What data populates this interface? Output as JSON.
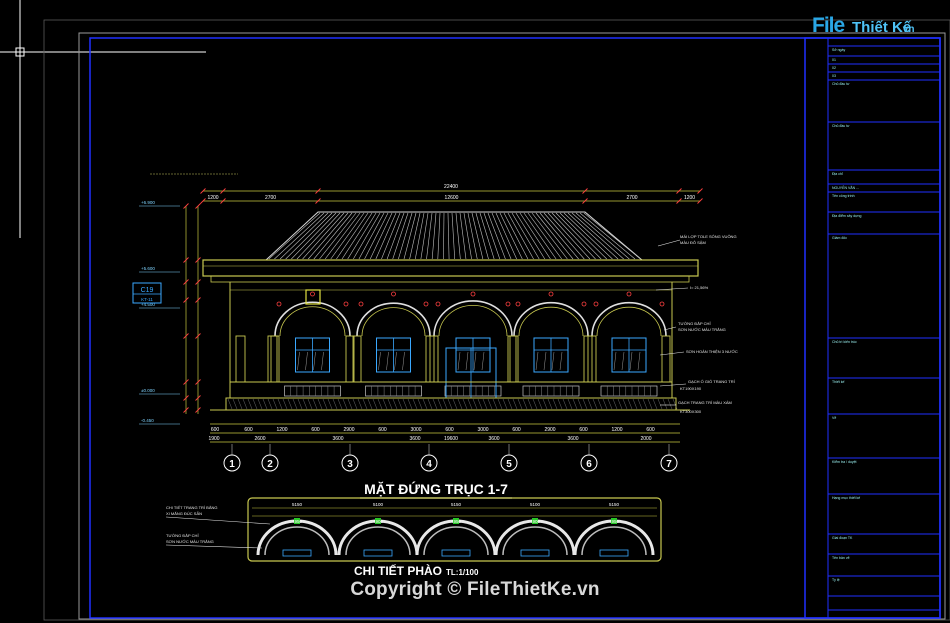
{
  "watermark": {
    "brand_first": "File",
    "brand_rest": "Thiết Kế",
    "brand_suffix": ".vn"
  },
  "copyright": "Copyright © FileThietKe.vn",
  "drawing": {
    "main_title": "MẶT ĐỨNG TRỤC 1-7",
    "detail_title": "CHI TIẾT PHÀO",
    "detail_scale": "TL:1/100",
    "section_tag": "C19",
    "section_sub": "KT-11",
    "top_dims": [
      "1200",
      "2700",
      "12600",
      "2700",
      "1200"
    ],
    "overall_dim": "22400",
    "bottom_dims": [
      "600",
      "600",
      "1200",
      "600",
      "2900",
      "600",
      "3000",
      "600",
      "3000",
      "600",
      "2900",
      "600",
      "1200",
      "600"
    ],
    "bottom_dims2": [
      "1900",
      "2600",
      "3600",
      "3600",
      "3600",
      "3600",
      "2000"
    ],
    "bottom_total": "19600",
    "axes": [
      "1",
      "2",
      "3",
      "4",
      "5",
      "6",
      "7"
    ],
    "levels": [
      "+6.900",
      "+5.600",
      "+4.500",
      "±0.000",
      "-0.450"
    ],
    "arch_dims": [
      "5150",
      "5100",
      "5150",
      "5100",
      "5150"
    ],
    "arch_inner": [
      "4950",
      "4900",
      "4950",
      "4900",
      "4950"
    ],
    "right_notes": [
      "MÁI LỢP TOLE SÓNG VUÔNG",
      "MÀU ĐỎ SẬM",
      "I= 21,56%",
      "TƯỜNG ĐẮP CHỈ",
      "SƠN NƯỚC MÀU TRẮNG",
      "SƠN HOÀN THIỆN 3 NƯỚC",
      "GẠCH Ố GIÓ TRANG TRÍ",
      "KT190X190",
      "GẠCH TRANG TRÍ MÀU XÁM",
      "KT300X300"
    ],
    "left_notes": [
      "CHI TIẾT TRANG TRÍ BẰNG",
      "XI MĂNG ĐÚC SẴN",
      "TƯỜNG ĐẮP CHỈ",
      "SƠN NƯỚC MÀU TRẮNG"
    ]
  },
  "title_block": {
    "rows": [
      "Sở ngày",
      "01",
      "02",
      "03",
      "Chủ đầu tư",
      "Chủ đầu tư",
      "Địa chỉ",
      "NGUYỄN VĂN ...",
      "Tên công trình",
      "Địa điểm xây dựng",
      "Giám đốc",
      "Chủ trì kiến trúc",
      "Thiết kế",
      "Vẽ",
      "Kiểm tra / duyệt",
      "Hạng mục thiết kế",
      "Giai đoạn TK",
      "Tên bản vẽ",
      "Tỷ lệ"
    ]
  }
}
